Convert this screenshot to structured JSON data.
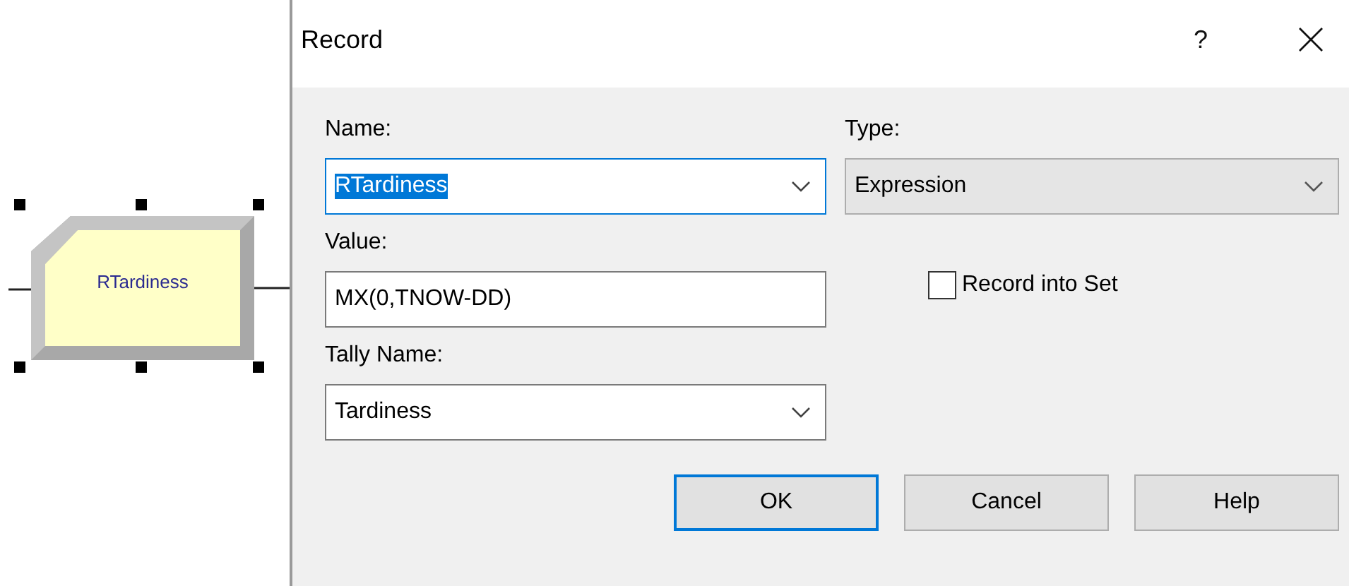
{
  "canvas": {
    "module": {
      "label": "RTardiness",
      "selected": true
    }
  },
  "window": {
    "title": "Record",
    "help": "?"
  },
  "name_field": {
    "label": "Name:",
    "value": "RTardiness",
    "focused": true,
    "text_selected": true
  },
  "type_field": {
    "label": "Type:",
    "value": "Expression"
  },
  "value_field": {
    "label": "Value:",
    "value": "MX(0,TNOW-DD)"
  },
  "record_into_set": {
    "label": "Record into Set",
    "checked": false
  },
  "tally_name_field": {
    "label": "Tally Name:",
    "value": "Tardiness"
  },
  "buttons": [
    {
      "label": "OK",
      "default": true
    },
    {
      "label": "Cancel",
      "default": false
    },
    {
      "label": "Help",
      "default": false
    }
  ]
}
